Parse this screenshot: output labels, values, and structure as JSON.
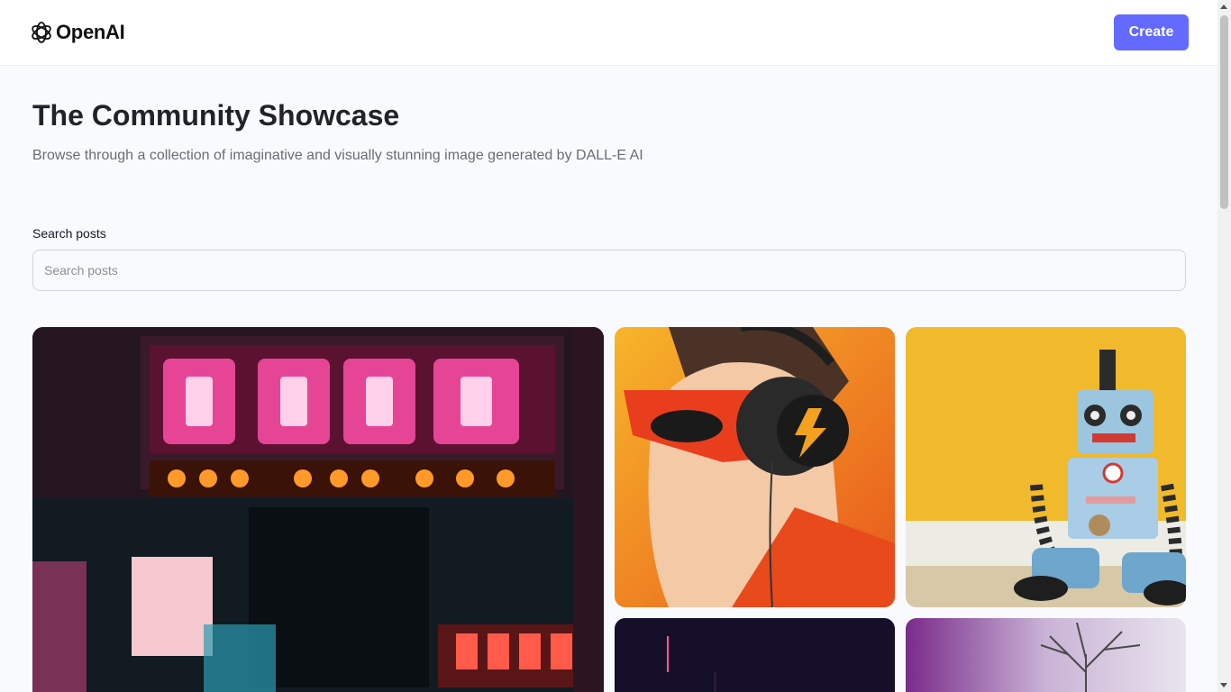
{
  "header": {
    "brand": "OpenAI",
    "logo_icon": "openai-logo-icon",
    "create_label": "Create"
  },
  "main": {
    "title": "The Community Showcase",
    "subtitle": "Browse through a collection of imaginative and visually stunning image generated by DALL-E AI",
    "search_label": "Search posts",
    "search_placeholder": "Search posts",
    "search_value": ""
  },
  "gallery": {
    "cards": [
      {
        "subject": "neon-city-street",
        "colors": [
          "#1a0f1a",
          "#ff2e8a",
          "#ff8a1a",
          "#2a9bb0"
        ]
      },
      {
        "subject": "superhero-with-headphones",
        "colors": [
          "#f29a26",
          "#e8401c",
          "#1e1e1e",
          "#f3c9a6"
        ]
      },
      {
        "subject": "toy-robot",
        "colors": [
          "#f1b92c",
          "#9cc5e0",
          "#e9e6dc",
          "#2b2b2b"
        ]
      },
      {
        "subject": "dark-night-scene",
        "colors": [
          "#0e0a1e",
          "#2b1a3a"
        ]
      },
      {
        "subject": "purple-tree",
        "colors": [
          "#7a2a8a",
          "#c9b3d6"
        ]
      }
    ]
  },
  "colors": {
    "accent": "#6469ff",
    "page_background": "#f9fafe",
    "title": "#222328",
    "subtitle": "#666e75"
  }
}
